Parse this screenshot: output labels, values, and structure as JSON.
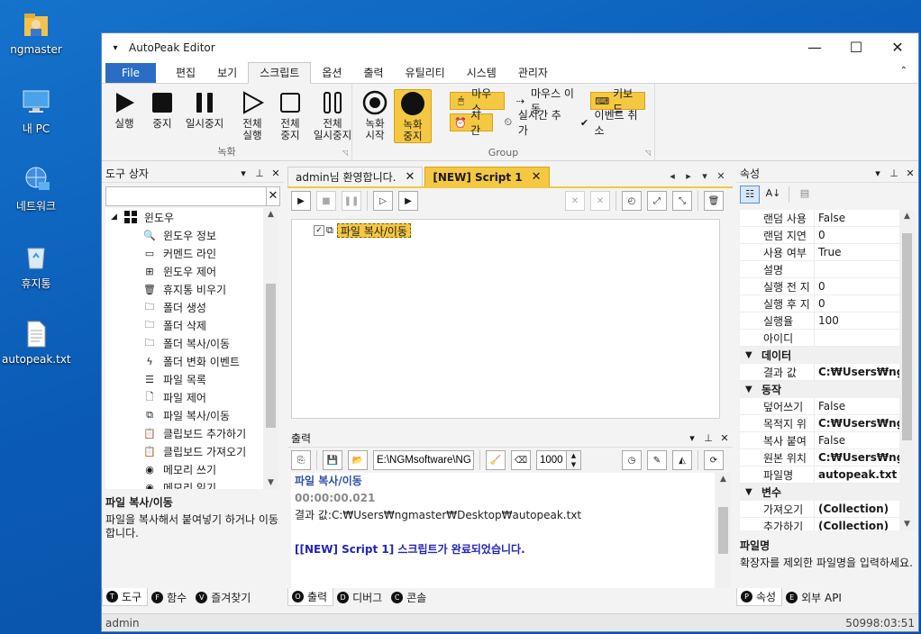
{
  "desktop": {
    "icons": [
      {
        "label": "ngmaster",
        "icon": "user-folder-icon"
      },
      {
        "label": "내 PC",
        "icon": "computer-icon"
      },
      {
        "label": "네트워크",
        "icon": "network-icon"
      },
      {
        "label": "휴지통",
        "icon": "recycle-bin-icon"
      },
      {
        "label": "autopeak.txt",
        "icon": "text-file-icon"
      }
    ]
  },
  "window": {
    "title": "AutoPeak Editor",
    "quick_access": "▾",
    "minimize": "—",
    "maximize": "☐",
    "close": "✕"
  },
  "menu": {
    "file": "File",
    "tabs": [
      "편집",
      "보기",
      "스크립트",
      "옵션",
      "출력",
      "유틸리티",
      "시스템",
      "관리자"
    ],
    "active_tab": "스크립트",
    "collapse": "⌃"
  },
  "ribbon": {
    "record_group": {
      "name": "녹화",
      "buttons": [
        {
          "label": "실행",
          "icon": "play-icon"
        },
        {
          "label": "중지",
          "icon": "stop-icon"
        },
        {
          "label": "일시중지",
          "icon": "pause-icon"
        },
        {
          "label": "전체\n실행",
          "icon": "play-all-icon"
        },
        {
          "label": "전체\n중지",
          "icon": "stop-all-icon"
        },
        {
          "label": "전체\n일시중지",
          "icon": "pause-all-icon"
        }
      ]
    },
    "group2": {
      "name": "Group",
      "buttons": [
        {
          "label": "녹화\n시작",
          "icon": "record-start-icon"
        },
        {
          "label": "녹화\n중지",
          "icon": "record-stop-icon"
        }
      ],
      "row1": [
        {
          "label": "마우스",
          "icon": "mouse-click-icon",
          "selected": true
        },
        {
          "label": "마우스 이동",
          "icon": "mouse-move-icon",
          "selected": false
        },
        {
          "label": "키보드",
          "icon": "keyboard-icon",
          "selected": true
        }
      ],
      "row2": [
        {
          "label": "시간",
          "icon": "alarm-icon",
          "selected": true
        },
        {
          "label": "실시간 추가",
          "icon": "alarm-add-icon",
          "selected": false
        },
        {
          "label": "이벤트 취소",
          "icon": "check-circle-icon",
          "selected": false
        }
      ]
    }
  },
  "toolbox": {
    "title": "도구 상자",
    "search_placeholder": "",
    "root": "윈도우",
    "items": [
      {
        "label": "윈도우 정보",
        "icon": "magnifier-icon"
      },
      {
        "label": "커멘드 라인",
        "icon": "console-icon"
      },
      {
        "label": "윈도우 제어",
        "icon": "windows-logo-icon"
      },
      {
        "label": "휴지통 비우기",
        "icon": "trash-empty-icon"
      },
      {
        "label": "폴더 생성",
        "icon": "folder-add-icon"
      },
      {
        "label": "폴더 삭제",
        "icon": "folder-delete-icon"
      },
      {
        "label": "폴더 복사/이동",
        "icon": "folder-copy-icon"
      },
      {
        "label": "폴더 변화 이벤트",
        "icon": "bolt-icon"
      },
      {
        "label": "파일 목록",
        "icon": "file-list-icon"
      },
      {
        "label": "파일 제어",
        "icon": "file-icon"
      },
      {
        "label": "파일 복사/이동",
        "icon": "file-copy-icon"
      },
      {
        "label": "클립보드 추가하기",
        "icon": "clipboard-add-icon"
      },
      {
        "label": "클립보드 가져오기",
        "icon": "clipboard-get-icon"
      },
      {
        "label": "메모리 쓰기",
        "icon": "memory-write-icon"
      },
      {
        "label": "메모리 읽기",
        "icon": "memory-read-icon"
      }
    ],
    "desc_title": "파일 복사/이동",
    "desc_text": "파일을 복사해서 붙여넣기 하거나 이동합니다.",
    "tabs": [
      {
        "letter": "T",
        "label": "도구"
      },
      {
        "letter": "F",
        "label": "함수"
      },
      {
        "letter": "V",
        "label": "즐겨찾기"
      }
    ]
  },
  "editor": {
    "tabs": [
      {
        "label": "admin님 환영합니다.",
        "active": false
      },
      {
        "label": "[NEW] Script 1",
        "active": true
      }
    ],
    "node_label": "파일 복사/이동"
  },
  "output": {
    "title": "출력",
    "path_value": "E:\\NGMsoftware\\NG",
    "count_value": "1000",
    "lines": [
      {
        "text": "파일 복사/이동",
        "color": "#2b4fa8",
        "bold": true
      },
      {
        "text": "00:00:00.021",
        "color": "#8a8a8a",
        "bold": true
      },
      {
        "text": "결과 값:C:₩Users₩ngmaster₩Desktop₩autopeak.txt",
        "color": "#222222",
        "bold": false
      },
      {
        "text": "",
        "color": "#222222",
        "bold": false
      },
      {
        "text": "[[NEW] Script 1] 스크립트가 완료되었습니다.",
        "color": "#2424b8",
        "bold": true
      }
    ],
    "tabs": [
      {
        "letter": "O",
        "label": "출력"
      },
      {
        "letter": "D",
        "label": "디버그"
      },
      {
        "letter": "C",
        "label": "콘솔"
      }
    ]
  },
  "properties": {
    "title": "속성",
    "rows_top": [
      {
        "k": "랜덤 사용",
        "v": "False"
      },
      {
        "k": "랜덤 지연",
        "v": "0"
      },
      {
        "k": "사용 여부",
        "v": "True"
      },
      {
        "k": "설명",
        "v": ""
      },
      {
        "k": "실행 전 지",
        "v": "0"
      },
      {
        "k": "실행 후 지",
        "v": "0"
      },
      {
        "k": "실행율",
        "v": "100"
      },
      {
        "k": "아이디",
        "v": ""
      }
    ],
    "cat_data": "데이터",
    "rows_data": [
      {
        "k": "결과 값",
        "v": "C:₩Users₩ngma",
        "bold": true
      }
    ],
    "cat_action": "동작",
    "rows_action": [
      {
        "k": "덮어쓰기",
        "v": "False",
        "bold": false
      },
      {
        "k": "목적지 위",
        "v": "C:₩Users₩ngma",
        "bold": true
      },
      {
        "k": "복사 붙여",
        "v": "False",
        "bold": false
      },
      {
        "k": "원본 위치",
        "v": "C:₩Users₩ngma",
        "bold": true
      },
      {
        "k": "파일명",
        "v": "autopeak.txt",
        "bold": true
      }
    ],
    "cat_var": "변수",
    "rows_var": [
      {
        "k": "가져오기",
        "v": "(Collection)",
        "bold": true
      },
      {
        "k": "추가하기",
        "v": "(Collection)",
        "bold": true
      }
    ],
    "desc_title": "파일명",
    "desc_text": "확장자를 제외한 파일명을 입력하세요.",
    "tabs": [
      {
        "letter": "P",
        "label": "속성"
      },
      {
        "letter": "E",
        "label": "외부 API"
      }
    ]
  },
  "status": {
    "user": "admin",
    "right": "50998:03:51"
  }
}
